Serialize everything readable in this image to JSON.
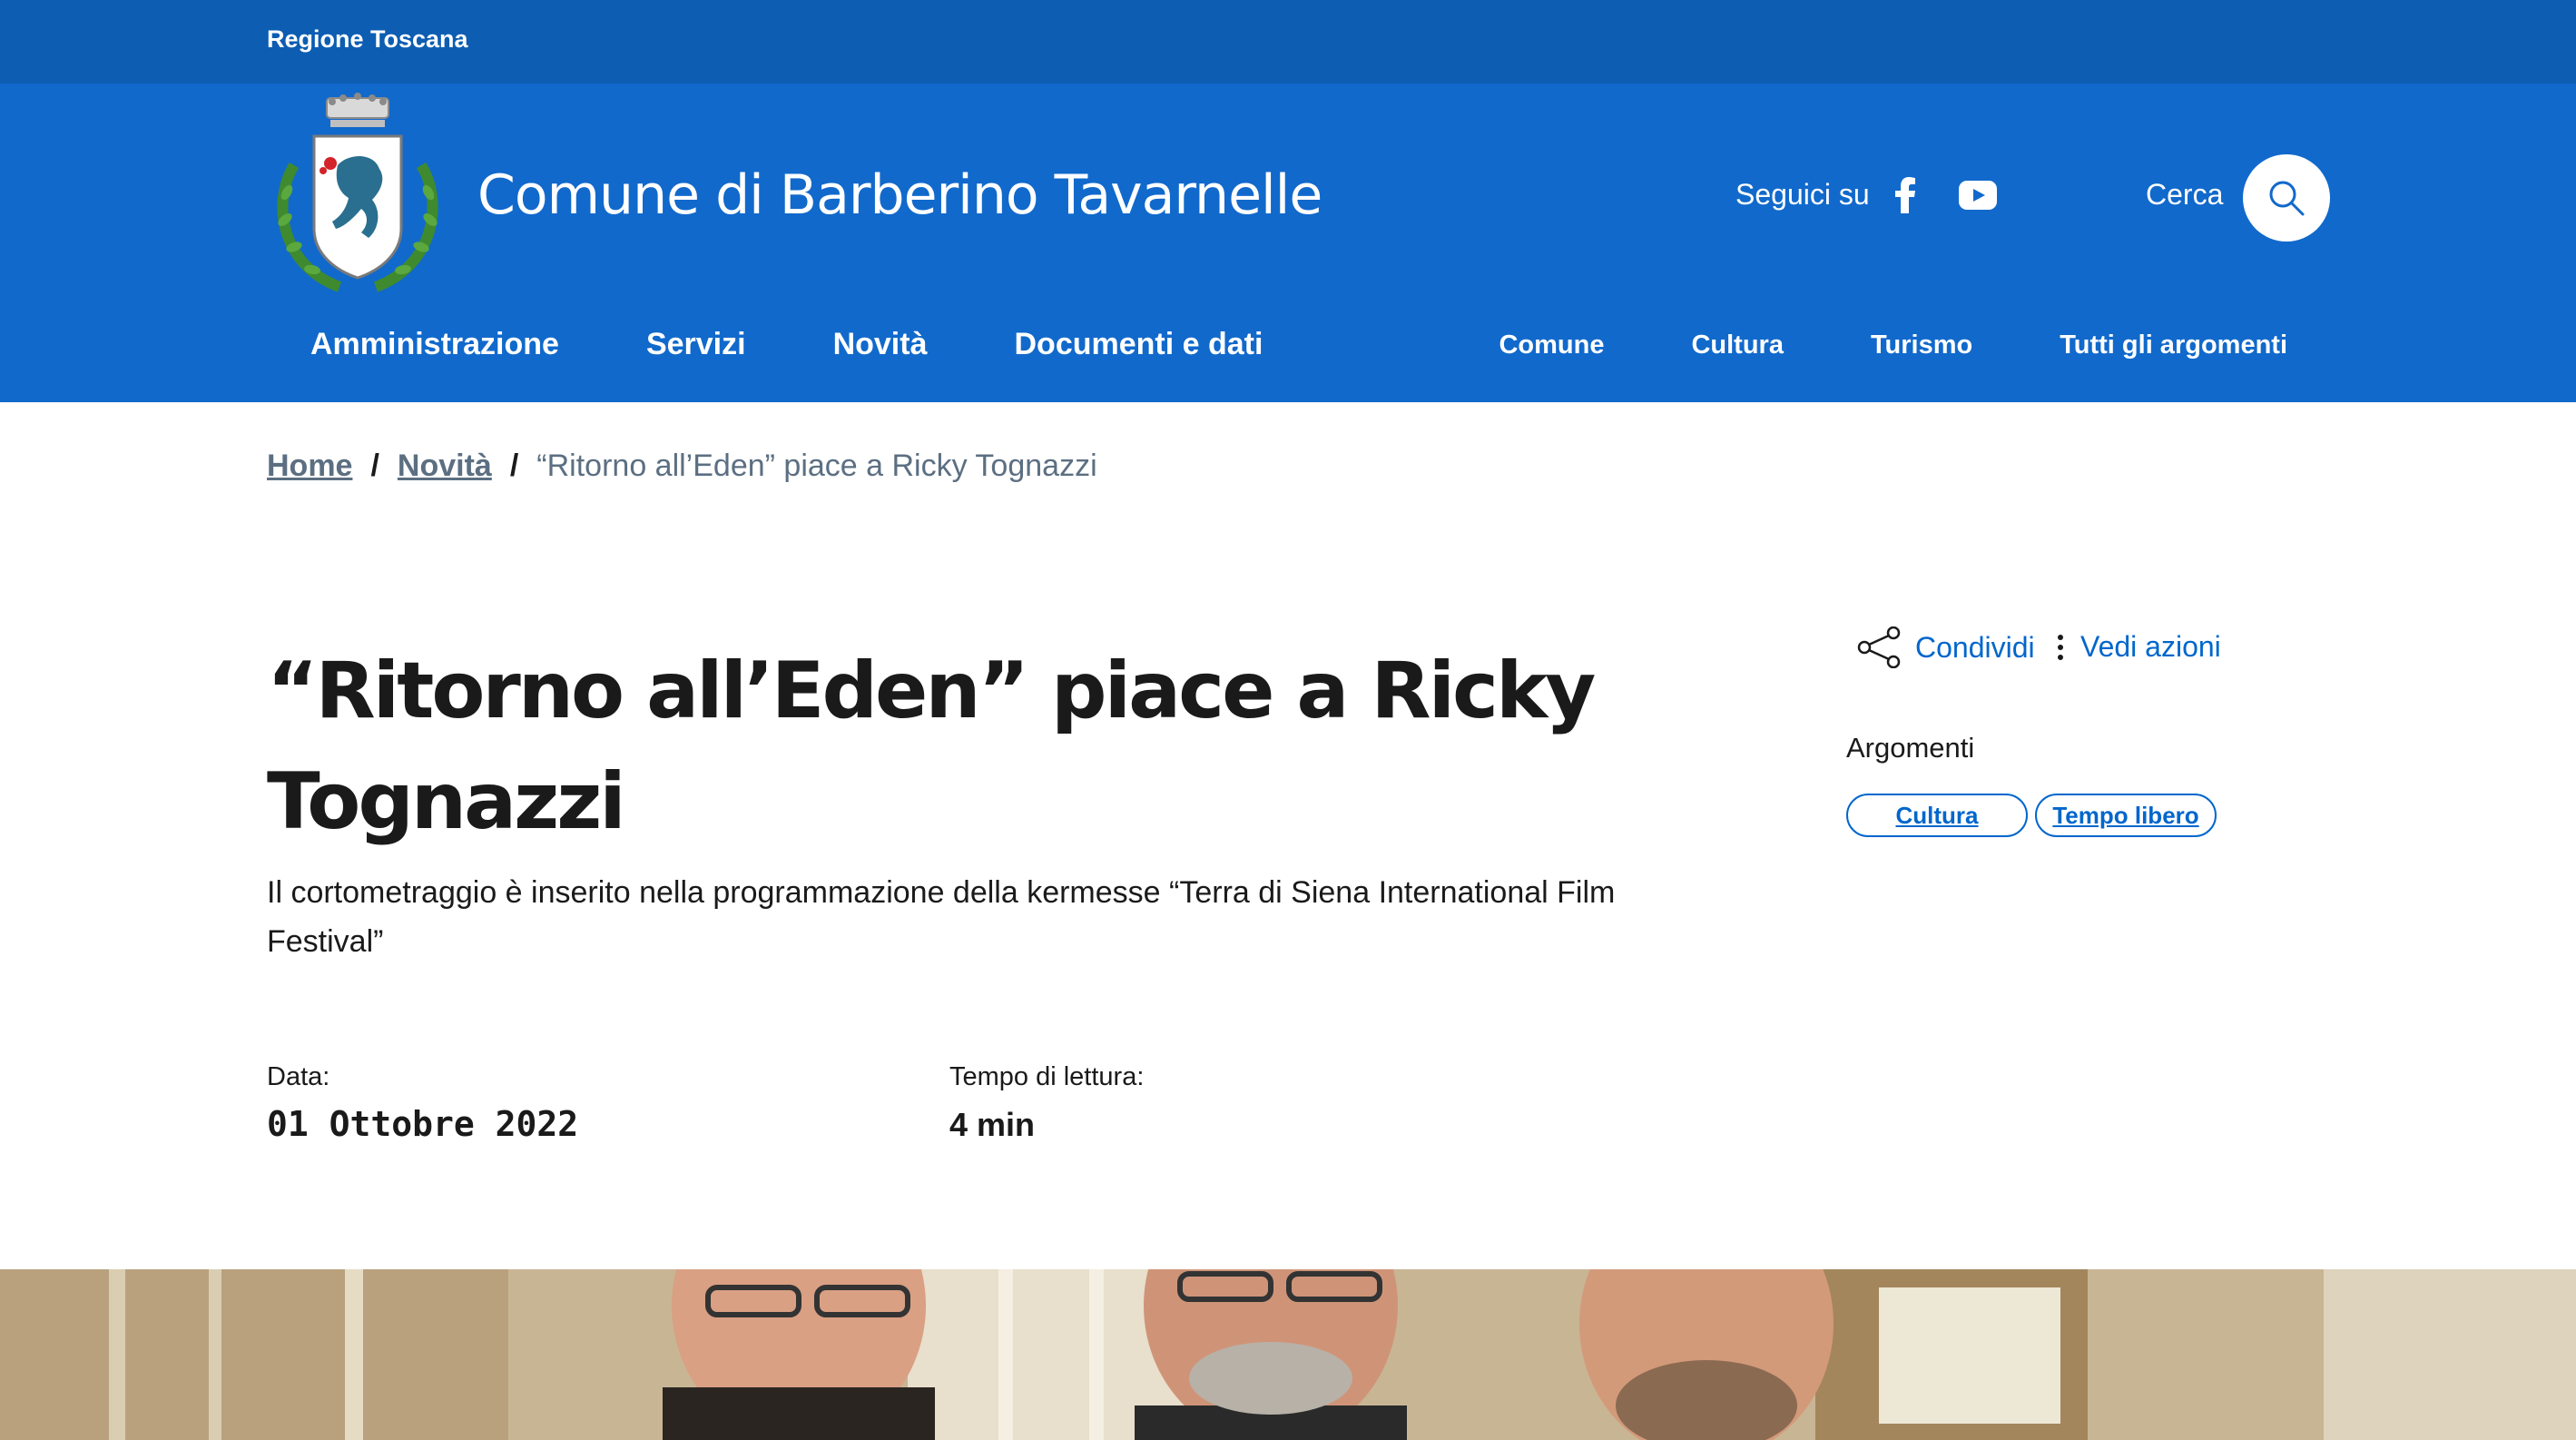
{
  "slim_header": {
    "region": "Regione Toscana"
  },
  "header": {
    "title": "Comune di Barberino Tavarnelle",
    "social_label": "Seguici su",
    "search_label": "Cerca"
  },
  "nav": {
    "main": [
      "Amministrazione",
      "Servizi",
      "Novità",
      "Documenti e dati"
    ],
    "secondary": [
      "Comune",
      "Cultura",
      "Turismo",
      "Tutti gli argomenti"
    ]
  },
  "breadcrumb": {
    "items": [
      "Home",
      "Novità"
    ],
    "separator": "/",
    "current": "“Ritorno all’Eden” piace a Ricky Tognazzi"
  },
  "article": {
    "title": "“Ritorno all’Eden” piace a Ricky Tognazzi",
    "lead": "Il cortometraggio è inserito nella programmazione della kermesse “Terra di Siena International Film Festival”",
    "date_label": "Data:",
    "date_value": "01 Ottobre 2022",
    "reading_label": "Tempo di lettura:",
    "reading_value": "4 min"
  },
  "sidebar": {
    "share_label": "Condividi",
    "actions_label": "Vedi azioni",
    "topics_title": "Argomenti",
    "topics": [
      "Cultura",
      "Tempo libero"
    ]
  },
  "colors": {
    "slim_bg": "#0d5db2",
    "header_bg": "#1169cc",
    "link": "#0066cc",
    "muted": "#5c6f82"
  },
  "icons": {
    "facebook": "facebook-icon",
    "youtube": "youtube-icon",
    "search": "search-icon",
    "share": "share-icon",
    "more": "more-vertical-icon"
  }
}
